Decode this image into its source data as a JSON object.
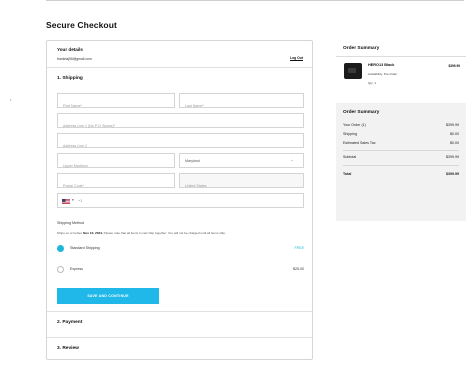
{
  "page": {
    "title": "Secure Checkout",
    "side_mark": "•"
  },
  "details": {
    "heading": "Your details",
    "email": "frankrlaj56@gmail.com",
    "logout": "Log Out"
  },
  "shipping": {
    "heading": "1. Shipping",
    "first_name_placeholder": "First Name*",
    "last_name_placeholder": "Last Name*",
    "address1_placeholder": "Address Line 1 (No P.O. Boxes)*",
    "address2_placeholder": "Address Line 2",
    "unit_placeholder": "Upper Marlboro",
    "state_value": "Maryland",
    "postal_placeholder": "Postal Code*",
    "country_placeholder": "United States",
    "phone_prefix": "+1",
    "method_label": "Shipping Method",
    "note_prefix": "Ships on or before",
    "note_date": "Nov 10, 2024.",
    "note_suffix": "Please note that all items in cart ship together. You will not be charged until all items ship.",
    "options": [
      {
        "label": "Standard Shipping",
        "price": "FREE",
        "selected": true
      },
      {
        "label": "Express",
        "price": "$25.00",
        "selected": false
      }
    ],
    "save_button": "SAVE AND CONTINUE"
  },
  "payment": {
    "heading": "2. Payment"
  },
  "review": {
    "heading": "3. Review"
  },
  "summary": {
    "heading": "Order Summary",
    "product": {
      "name": "HERO13 Black",
      "availability": "Availability: Pre-Order",
      "qty": "Qty: 1",
      "price": "$399.99"
    },
    "totals_heading": "Order Summary",
    "rows": [
      {
        "label": "Your Order (1)",
        "value": "$399.99"
      },
      {
        "label": "Shipping",
        "value": "$0.00"
      },
      {
        "label": "Estimated Sales Tax",
        "value": "$0.00"
      }
    ],
    "subtotal": {
      "label": "Subtotal",
      "value": "$399.99"
    },
    "total": {
      "label": "Total",
      "value": "$399.99"
    }
  },
  "colors": {
    "accent": "#1fb8e8",
    "radio_selected": "#1eb6d9"
  }
}
